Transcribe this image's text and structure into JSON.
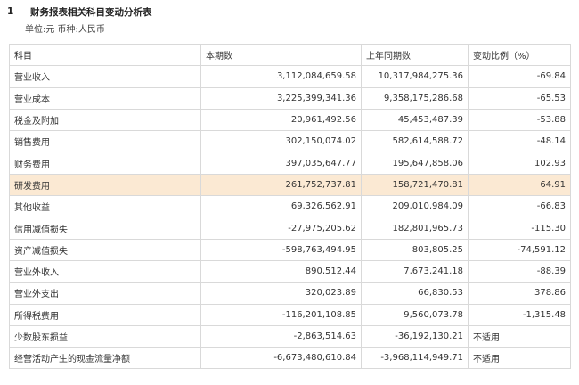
{
  "header": {
    "section_number": "1",
    "title": "财务报表相关科目变动分析表",
    "unit": "单位:元 币种:人民币"
  },
  "table": {
    "columns": [
      "科目",
      "本期数",
      "上年同期数",
      "变动比例（%）"
    ],
    "rows": [
      {
        "item": "营业收入",
        "current": "3,112,084,659.58",
        "prior": "10,317,984,275.36",
        "change": "-69.84"
      },
      {
        "item": "营业成本",
        "current": "3,225,399,341.36",
        "prior": "9,358,175,286.68",
        "change": "-65.53"
      },
      {
        "item": "税金及附加",
        "current": "20,961,492.56",
        "prior": "45,453,487.39",
        "change": "-53.88"
      },
      {
        "item": "销售费用",
        "current": "302,150,074.02",
        "prior": "582,614,588.72",
        "change": "-48.14"
      },
      {
        "item": "财务费用",
        "current": "397,035,647.77",
        "prior": "195,647,858.06",
        "change": "102.93"
      },
      {
        "item": "研发费用",
        "current": "261,752,737.81",
        "prior": "158,721,470.81",
        "change": "64.91",
        "highlight": true
      },
      {
        "item": "其他收益",
        "current": "69,326,562.91",
        "prior": "209,010,984.09",
        "change": "-66.83"
      },
      {
        "item": "信用减值损失",
        "current": "-27,975,205.62",
        "prior": "182,801,965.73",
        "change": "-115.30"
      },
      {
        "item": "资产减值损失",
        "current": "-598,763,494.95",
        "prior": "803,805.25",
        "change": "-74,591.12"
      },
      {
        "item": "营业外收入",
        "current": "890,512.44",
        "prior": "7,673,241.18",
        "change": "-88.39"
      },
      {
        "item": "营业外支出",
        "current": "320,023.89",
        "prior": "66,830.53",
        "change": "378.86"
      },
      {
        "item": "所得税费用",
        "current": "-116,201,108.85",
        "prior": "9,560,073.78",
        "change": "-1,315.48"
      },
      {
        "item": "少数股东损益",
        "current": "-2,863,514.63",
        "prior": "-36,192,130.21",
        "change": "不适用",
        "na": true
      },
      {
        "item": "经营活动产生的现金流量净额",
        "current": "-6,673,480,610.84",
        "prior": "-3,968,114,949.71",
        "change": "不适用",
        "na": true
      }
    ]
  },
  "icons": {
    "copy": "copy-icon"
  },
  "colors": {
    "highlight_row": "#fbe9d3",
    "border": "#d9d9d9"
  }
}
